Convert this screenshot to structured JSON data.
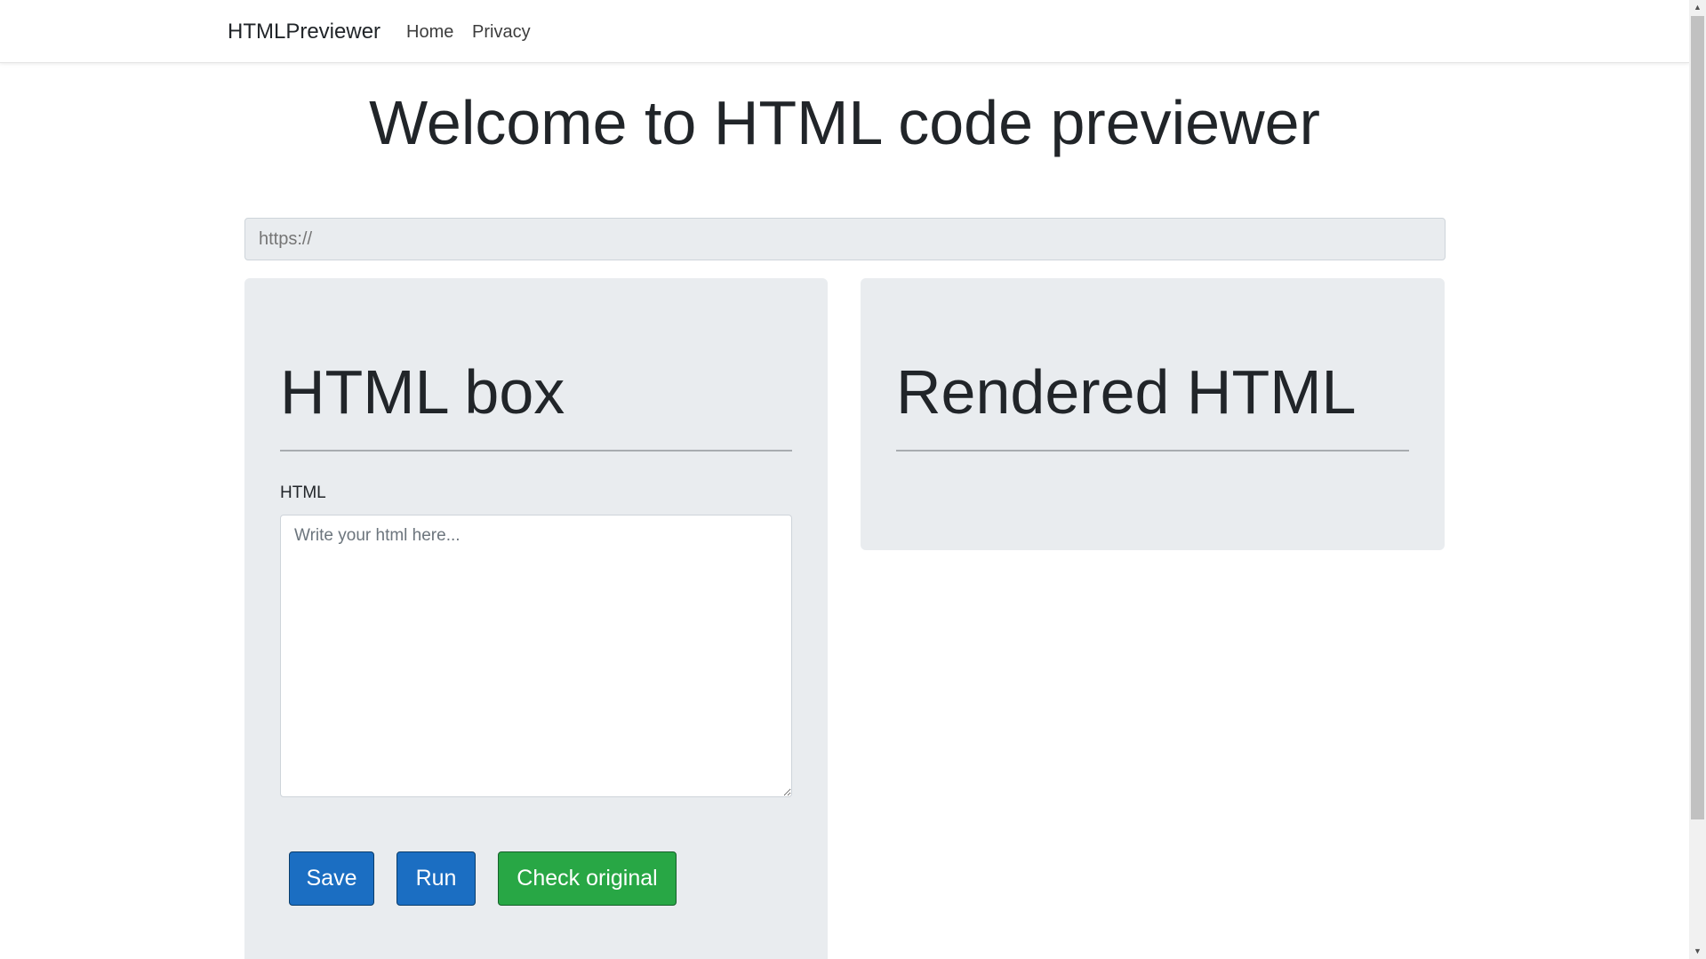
{
  "navbar": {
    "brand": "HTMLPreviewer",
    "links": [
      {
        "label": "Home"
      },
      {
        "label": "Privacy"
      }
    ]
  },
  "main": {
    "title": "Welcome to HTML code previewer",
    "url_input": {
      "value": "",
      "placeholder": "https://"
    },
    "html_box": {
      "heading": "HTML box",
      "field_label": "HTML",
      "textarea": {
        "value": "",
        "placeholder": "Write your html here..."
      },
      "buttons": {
        "save": "Save",
        "run": "Run",
        "check_original": "Check original"
      }
    },
    "rendered": {
      "heading": "Rendered HTML"
    }
  },
  "scrollbar": {
    "up_icon": "triangle-up-icon",
    "down_icon": "triangle-down-icon"
  },
  "colors": {
    "primary_button": "#1b6ec2",
    "success_button": "#28a745",
    "panel_background": "#e9ecef"
  }
}
